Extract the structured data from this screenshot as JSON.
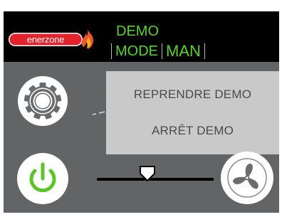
{
  "header": {
    "logo_text": "enerzone",
    "status_line1": "DEMO",
    "status_mode": "MODE",
    "status_man": "MAN"
  },
  "popup_menu": {
    "items": [
      {
        "label": "REPRENDRE DEMO"
      },
      {
        "label": "ARRÊT DEMO"
      }
    ]
  },
  "icons": {
    "settings": "gear-icon",
    "power": "power-icon",
    "fan": "fan-icon",
    "slider_thumb": "slider-thumb-icon",
    "logo_flame": "flame-icon"
  },
  "colors": {
    "header_background": "#000000",
    "screen_background": "#636466",
    "status_text": "#59d32a",
    "logo_red": "#e3232b",
    "power_green": "#5bc42b",
    "popup_background": "#c9c9ca",
    "popup_text": "#4a4a4c"
  }
}
